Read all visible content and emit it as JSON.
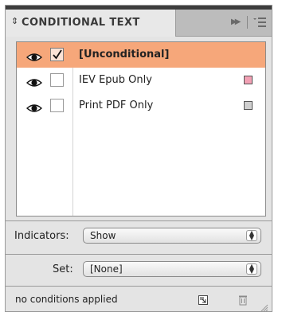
{
  "panel": {
    "title": "CONDITIONAL TEXT",
    "collapse_glyph": "↕"
  },
  "conditions": [
    {
      "label": "[Unconditional]",
      "visible_icon": "eye-icon",
      "checked": true,
      "selected": true,
      "swatch": null
    },
    {
      "label": "IEV Epub Only",
      "visible_icon": "eye-icon",
      "checked": false,
      "selected": false,
      "swatch": "#f2a0b4"
    },
    {
      "label": "Print PDF Only",
      "visible_icon": "eye-icon",
      "checked": false,
      "selected": false,
      "swatch": "#cfcfcf"
    }
  ],
  "indicators": {
    "label": "Indicators:",
    "value": "Show"
  },
  "set": {
    "label": "Set:",
    "value": "[None]"
  },
  "status": {
    "text": "no conditions applied"
  },
  "colors": {
    "selection": "#f6a77a",
    "panel_bg": "#e4e4e4",
    "header_bg": "#bcbcbc"
  }
}
